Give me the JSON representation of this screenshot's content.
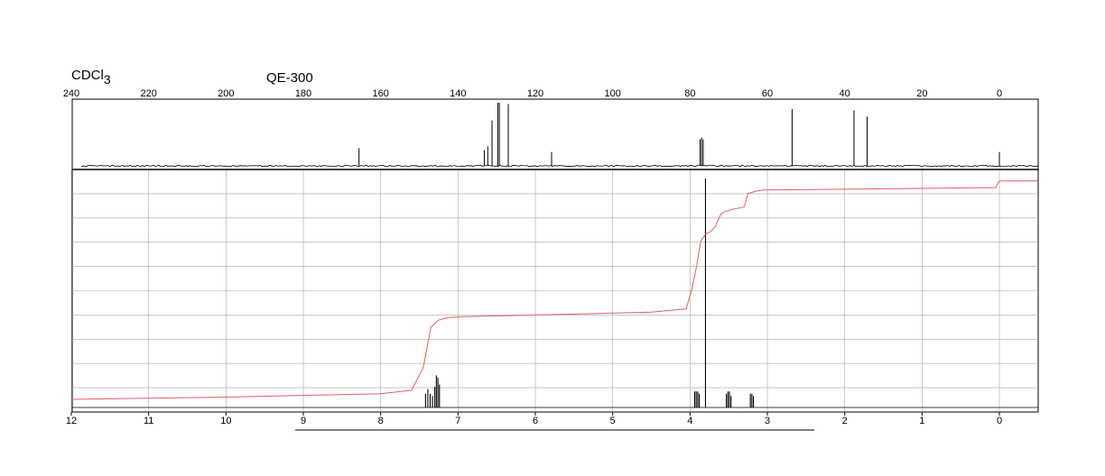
{
  "header": {
    "solvent_main": "CDCl",
    "solvent_sub": "3",
    "instrument": "QE-300"
  },
  "colors": {
    "spectrum": "#000000",
    "integral": "#e06060",
    "grid": "#a8a8a8",
    "frame": "#000000"
  },
  "chart_data": [
    {
      "type": "line",
      "title": "",
      "xlabel": "",
      "ylabel": "",
      "x_unit": "ppm",
      "xlim": [
        240,
        -10
      ],
      "x_reversed": true,
      "xticks": [
        240,
        220,
        200,
        180,
        160,
        140,
        120,
        100,
        80,
        60,
        40,
        20,
        0
      ],
      "grid": false,
      "series": [
        {
          "kind": "peaks",
          "x": [
            165.6,
            133.2,
            132.3,
            131.2,
            129.7,
            129.3,
            127.0,
            115.8,
            77.4,
            77.0,
            76.6,
            53.6,
            37.6,
            34.2,
            0.0
          ],
          "y": [
            0.28,
            0.25,
            0.31,
            0.72,
            1.0,
            1.0,
            0.98,
            0.22,
            0.42,
            0.45,
            0.42,
            0.9,
            0.88,
            0.78,
            0.22
          ]
        }
      ]
    },
    {
      "type": "line",
      "title": "",
      "xlabel": "",
      "ylabel": "",
      "x_unit": "ppm",
      "xlim": [
        12,
        -0.5
      ],
      "x_reversed": true,
      "xticks": [
        12,
        11,
        10,
        9,
        8,
        7,
        6,
        5,
        4,
        3,
        2,
        1,
        0
      ],
      "grid": true,
      "series": [
        {
          "kind": "peaks",
          "x": [
            7.42,
            7.39,
            7.36,
            7.33,
            7.3,
            7.28,
            7.26,
            7.24,
            3.94,
            3.92,
            3.9,
            3.88,
            3.8,
            3.53,
            3.51,
            3.49,
            3.47,
            3.22,
            3.2,
            3.18
          ],
          "y": [
            0.06,
            0.08,
            0.06,
            0.05,
            0.09,
            0.14,
            0.13,
            0.1,
            0.07,
            0.07,
            0.07,
            0.06,
            1.0,
            0.06,
            0.07,
            0.07,
            0.05,
            0.06,
            0.06,
            0.05
          ]
        },
        {
          "kind": "integral",
          "x": [
            12.0,
            10.0,
            8.0,
            7.6,
            7.45,
            7.35,
            7.25,
            7.15,
            7.0,
            4.5,
            4.05,
            3.98,
            3.92,
            3.86,
            3.8,
            3.74,
            3.68,
            3.6,
            3.55,
            3.45,
            3.3,
            3.25,
            3.15,
            3.05,
            0.3,
            0.05,
            0.0,
            -0.5
          ],
          "y": [
            0.02,
            0.03,
            0.045,
            0.06,
            0.16,
            0.34,
            0.37,
            0.38,
            0.385,
            0.405,
            0.42,
            0.5,
            0.6,
            0.72,
            0.75,
            0.76,
            0.78,
            0.84,
            0.85,
            0.86,
            0.87,
            0.93,
            0.94,
            0.945,
            0.955,
            0.955,
            0.985,
            0.985
          ]
        }
      ]
    }
  ]
}
